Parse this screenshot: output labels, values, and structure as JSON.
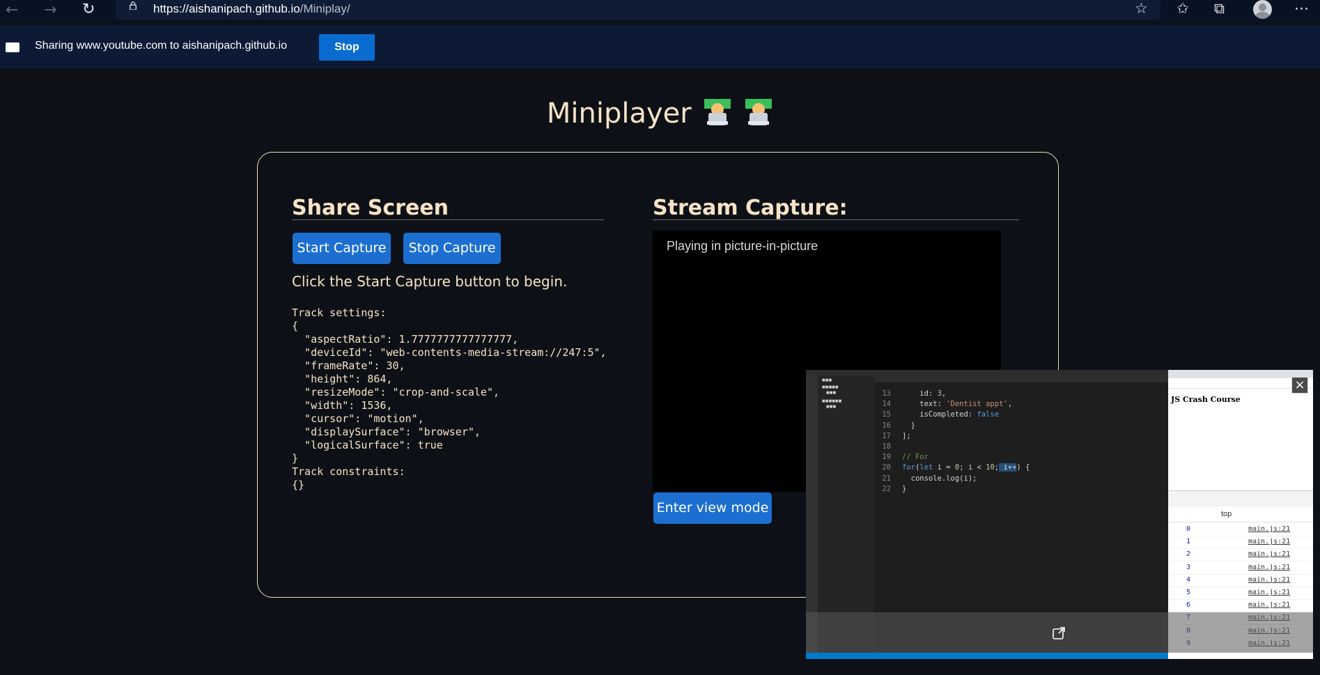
{
  "browser": {
    "url_host": "https://aishanipach.github.io",
    "url_path": "/Miniplay/",
    "share_text": "Sharing www.youtube.com to aishanipach.github.io",
    "stop_label": "Stop"
  },
  "page": {
    "title": "Miniplayer",
    "share_section": {
      "heading": "Share Screen",
      "start_label": "Start Capture",
      "stop_label": "Stop Capture",
      "hint": "Click the Start Capture button to begin.",
      "settings_text": "Track settings:\n{\n  \"aspectRatio\": 1.7777777777777777,\n  \"deviceId\": \"web-contents-media-stream://247:5\",\n  \"frameRate\": 30,\n  \"height\": 864,\n  \"resizeMode\": \"crop-and-scale\",\n  \"width\": 1536,\n  \"cursor\": \"motion\",\n  \"displaySurface\": \"browser\",\n  \"logicalSurface\": true\n}\nTrack constraints:\n{}"
    },
    "stream_section": {
      "heading": "Stream Capture:",
      "pip_text": "Playing in picture-in-picture",
      "view_mode_label": "Enter view mode"
    }
  },
  "pip_window": {
    "code_lines": [
      {
        "n": "13",
        "html": "    id: <span class=\"num\">3</span>,"
      },
      {
        "n": "14",
        "html": "    text: <span class=\"str\">'Dentist appt'</span>,"
      },
      {
        "n": "15",
        "html": "    isCompleted: <span class=\"kw\">false</span>"
      },
      {
        "n": "16",
        "html": "  }"
      },
      {
        "n": "17",
        "html": "];"
      },
      {
        "n": "18",
        "html": ""
      },
      {
        "n": "19",
        "html": "<span class=\"cm\">// For</span>"
      },
      {
        "n": "20",
        "html": "<span class=\"kw\">for</span>(<span class=\"kw\">let</span> i = <span class=\"num\">0</span>; i &lt; <span class=\"num\">10</span>;<span class=\"sel\"> i++</span>) {"
      },
      {
        "n": "21",
        "html": "  console.log(i);"
      },
      {
        "n": "22",
        "html": "}"
      }
    ],
    "browser_heading": "JS Crash Course",
    "devtools_context": "top",
    "log_values": [
      "0",
      "1",
      "2",
      "3",
      "4",
      "5",
      "6",
      "7",
      "8",
      "9"
    ],
    "log_source": "main.js:21",
    "close_symbol": "×"
  }
}
